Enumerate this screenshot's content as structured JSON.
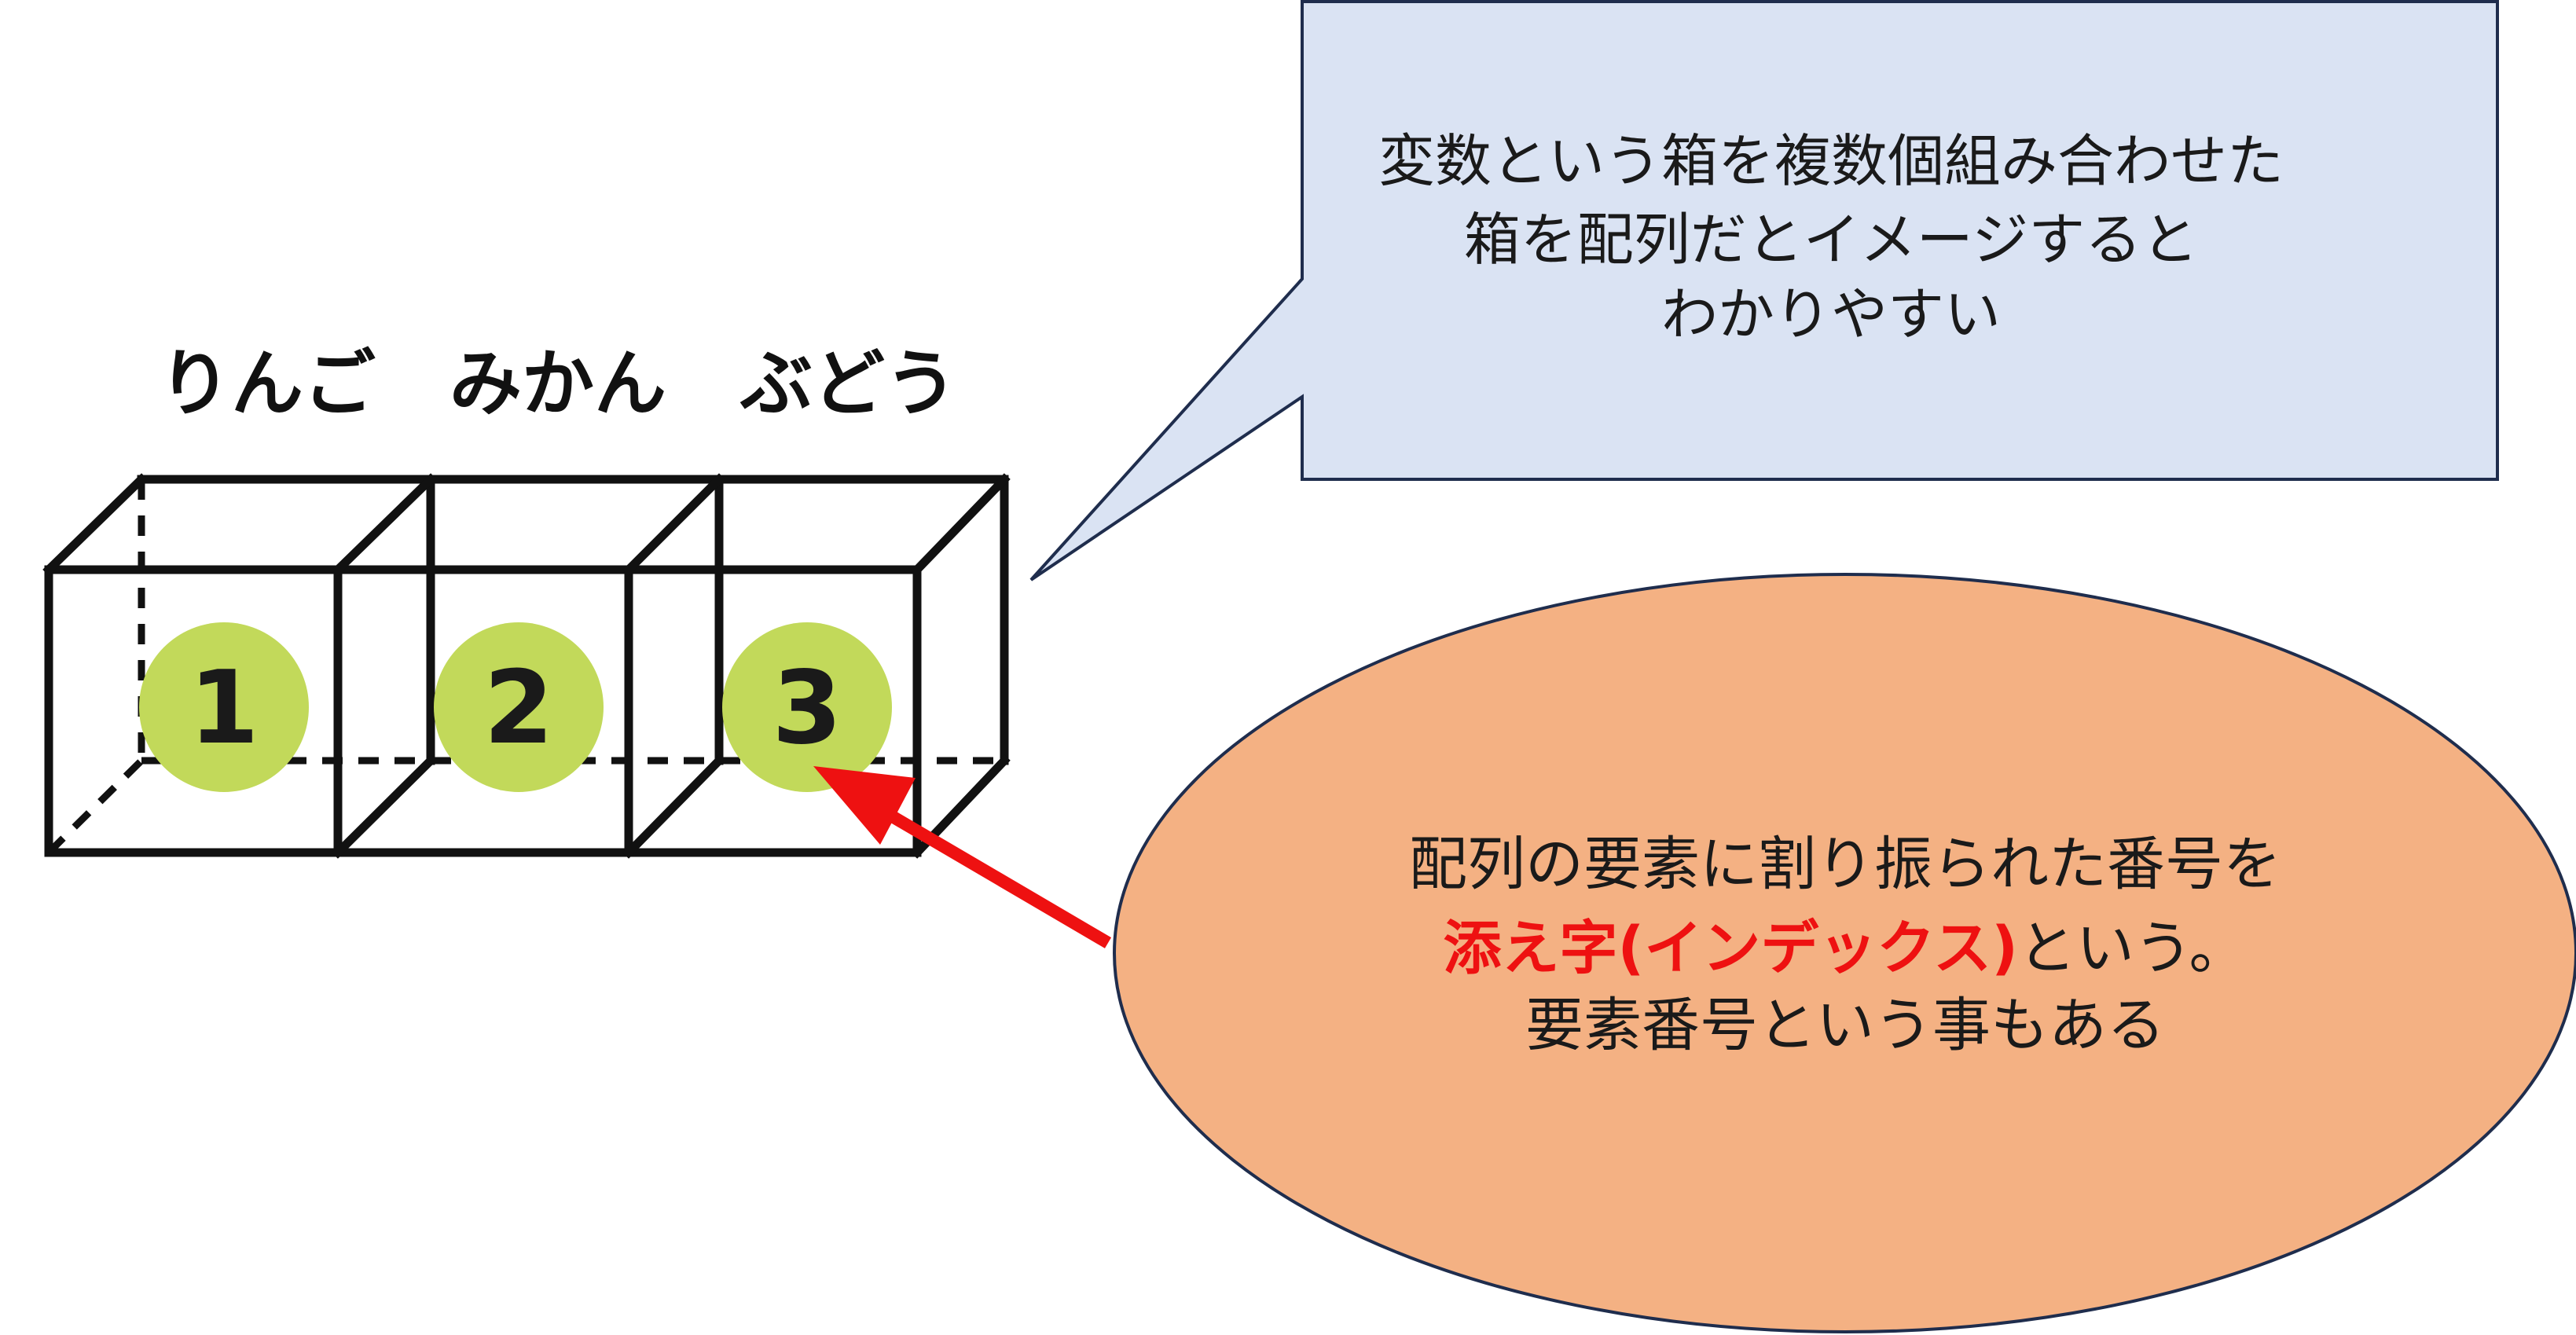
{
  "labels": [
    "りんご",
    "みかん",
    "ぶどう"
  ],
  "indices": [
    "1",
    "2",
    "3"
  ],
  "callout": {
    "lines": [
      "変数という箱を複数個組み合わせた",
      "箱を配列だとイメージすると",
      "わかりやすい"
    ]
  },
  "ellipse": {
    "line1": "配列の要素に割り振られた番号を",
    "line2_highlight": "添え字(インデックス)",
    "line2_rest": "という。",
    "line3": "要素番号という事もある"
  },
  "colors": {
    "index_circle": "#c2d95a",
    "callout_fill": "#dae3f3",
    "callout_stroke": "#1f2d4d",
    "ellipse_fill": "#f4b183",
    "ellipse_stroke": "#1f2d4d",
    "arrow": "#ee1111",
    "highlight_text": "#ee1111"
  }
}
